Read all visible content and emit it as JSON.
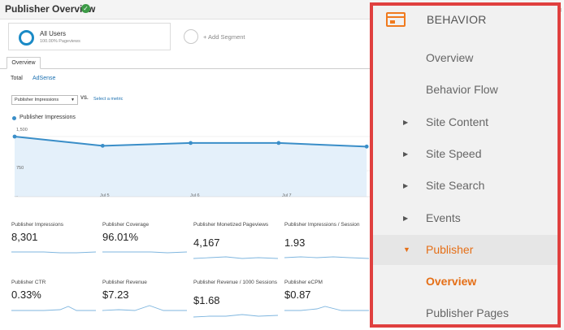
{
  "report": {
    "title": "Publisher Overview",
    "segment": {
      "name": "All Users",
      "sub": "100.00% Pageviews"
    },
    "add_segment": "+ Add Segment",
    "tab": "Overview",
    "subtabs": {
      "total": "Total",
      "adsense": "AdSense"
    },
    "metric_select": "Publisher Impressions",
    "vs": "VS.",
    "select_metric": "Select a metric",
    "legend": "Publisher Impressions"
  },
  "chart_data": {
    "type": "line",
    "series": [
      {
        "name": "Publisher Impressions",
        "values": [
          1500,
          1270,
          1340,
          1340,
          1250
        ]
      }
    ],
    "x_tick_labels": [
      "...",
      "Jul 5",
      "Jul 6",
      "Jul 7",
      ""
    ],
    "y_tick_labels": [
      "1,500",
      "750"
    ],
    "ylim": [
      0,
      1500
    ],
    "color": "#3a8ec8"
  },
  "cards_row1": [
    {
      "label": "Publisher Impressions",
      "value": "8,301"
    },
    {
      "label": "Publisher Coverage",
      "value": "96.01%"
    },
    {
      "label": "Publisher Monetized Pageviews",
      "value": "4,167"
    },
    {
      "label": "Publisher Impressions / Session",
      "value": "1.93"
    }
  ],
  "cards_row2": [
    {
      "label": "Publisher CTR",
      "value": "0.33%"
    },
    {
      "label": "Publisher Revenue",
      "value": "$7.23"
    },
    {
      "label": "Publisher Revenue / 1000 Sessions",
      "value": "$1.68"
    },
    {
      "label": "Publisher eCPM",
      "value": "$0.87"
    }
  ],
  "menu": {
    "header": "BEHAVIOR",
    "items": [
      {
        "label": "Overview"
      },
      {
        "label": "Behavior Flow"
      },
      {
        "label": "Site Content",
        "arrow": "▶"
      },
      {
        "label": "Site Speed",
        "arrow": "▶"
      },
      {
        "label": "Site Search",
        "arrow": "▶"
      },
      {
        "label": "Events",
        "arrow": "▶"
      },
      {
        "label": "Publisher",
        "arrow": "▼"
      },
      {
        "label": "Overview"
      },
      {
        "label": "Publisher Pages"
      }
    ],
    "accent_color": "#e56f17",
    "highlight_border": "#e0403f"
  }
}
